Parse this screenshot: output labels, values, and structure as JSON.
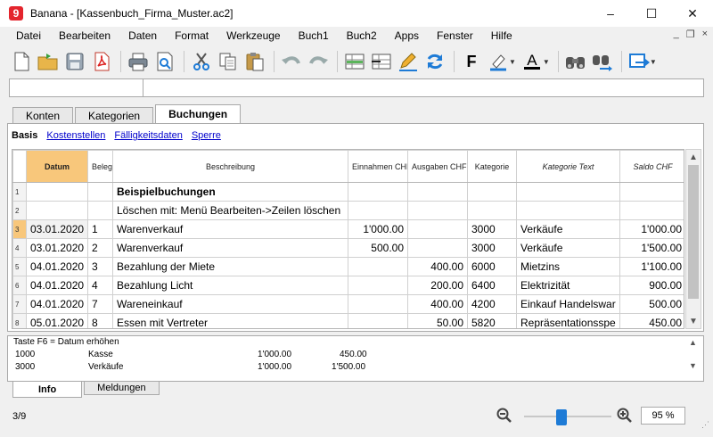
{
  "window": {
    "title": "Banana - [Kassenbuch_Firma_Muster.ac2]",
    "app_logo_letter": "9",
    "minimize": "–",
    "maximize": "☐",
    "close": "✕"
  },
  "menu": [
    "Datei",
    "Bearbeiten",
    "Daten",
    "Format",
    "Werkzeuge",
    "Buch1",
    "Buch2",
    "Apps",
    "Fenster",
    "Hilfe"
  ],
  "mdi_controls": [
    "_",
    "❐",
    "×"
  ],
  "toolbar": {
    "icons": [
      "new-document-icon",
      "open-folder-icon",
      "save-icon",
      "pdf-icon",
      "print-icon",
      "print-preview-icon",
      "cut-icon",
      "copy-icon",
      "paste-icon",
      "undo-icon",
      "redo-icon",
      "insert-row-icon",
      "delete-row-icon",
      "edit-icon",
      "recalculate-icon",
      "bold-icon",
      "highlight-icon",
      "font-color-icon",
      "find-icon",
      "find-replace-icon",
      "navigate-icon"
    ],
    "bold_label": "F",
    "font_color_label": "A"
  },
  "colors": {
    "selected_column": "#f8c77b",
    "zoom_accent": "#1e7bd6",
    "link": "#0000cc",
    "logo": "#e4252d"
  },
  "top_tabs": [
    "Konten",
    "Kategorien",
    "Buchungen"
  ],
  "active_top_tab": "Buchungen",
  "views": {
    "active": "Basis",
    "links": [
      "Kostenstellen",
      "Fälligkeitsdaten",
      "Sperre"
    ]
  },
  "grid": {
    "columns": [
      "Datum",
      "Beleg",
      "Beschreibung",
      "Einnahmen CHF",
      "Ausgaben CHF",
      "Kategorie",
      "Kategorie Text",
      "Saldo CHF"
    ],
    "rows": [
      {
        "n": "1",
        "date": "",
        "doc": "",
        "desc": "Beispielbuchungen",
        "income": "",
        "expense": "",
        "cat": "",
        "cat_text": "",
        "balance": ""
      },
      {
        "n": "2",
        "date": "",
        "doc": "",
        "desc": "Löschen mit: Menü Bearbeiten->Zeilen löschen",
        "income": "",
        "expense": "",
        "cat": "",
        "cat_text": "",
        "balance": ""
      },
      {
        "n": "3",
        "date": "03.01.2020",
        "doc": "1",
        "desc": "Warenverkauf",
        "income": "1'000.00",
        "expense": "",
        "cat": "3000",
        "cat_text": "Verkäufe",
        "balance": "1'000.00"
      },
      {
        "n": "4",
        "date": "03.01.2020",
        "doc": "2",
        "desc": "Warenverkauf",
        "income": "500.00",
        "expense": "",
        "cat": "3000",
        "cat_text": "Verkäufe",
        "balance": "1'500.00"
      },
      {
        "n": "5",
        "date": "04.01.2020",
        "doc": "3",
        "desc": "Bezahlung der Miete",
        "income": "",
        "expense": "400.00",
        "cat": "6000",
        "cat_text": "Mietzins",
        "balance": "1'100.00"
      },
      {
        "n": "6",
        "date": "04.01.2020",
        "doc": "4",
        "desc": "Bezahlung Licht",
        "income": "",
        "expense": "200.00",
        "cat": "6400",
        "cat_text": "Elektrizität",
        "balance": "900.00"
      },
      {
        "n": "7",
        "date": "04.01.2020",
        "doc": "7",
        "desc": "Wareneinkauf",
        "income": "",
        "expense": "400.00",
        "cat": "4200",
        "cat_text": "Einkauf Handelswar",
        "balance": "500.00"
      },
      {
        "n": "8",
        "date": "05.01.2020",
        "doc": "8",
        "desc": "Essen mit Vertreter",
        "income": "",
        "expense": "50.00",
        "cat": "5820",
        "cat_text": "Repräsentationsspe",
        "balance": "450.00"
      }
    ]
  },
  "info_panel": {
    "title": "Taste F6 = Datum erhöhen",
    "rows": [
      {
        "account": "1000",
        "name": "Kasse",
        "v1": "1'000.00",
        "v2": "450.00"
      },
      {
        "account": "3000",
        "name": "Verkäufe",
        "v1": "1'000.00",
        "v2": "1'500.00"
      }
    ]
  },
  "bottom_tabs": [
    "Info",
    "Meldungen"
  ],
  "status": {
    "position": "3/9",
    "zoom": "95 %",
    "zoom_fraction": 0.42
  }
}
